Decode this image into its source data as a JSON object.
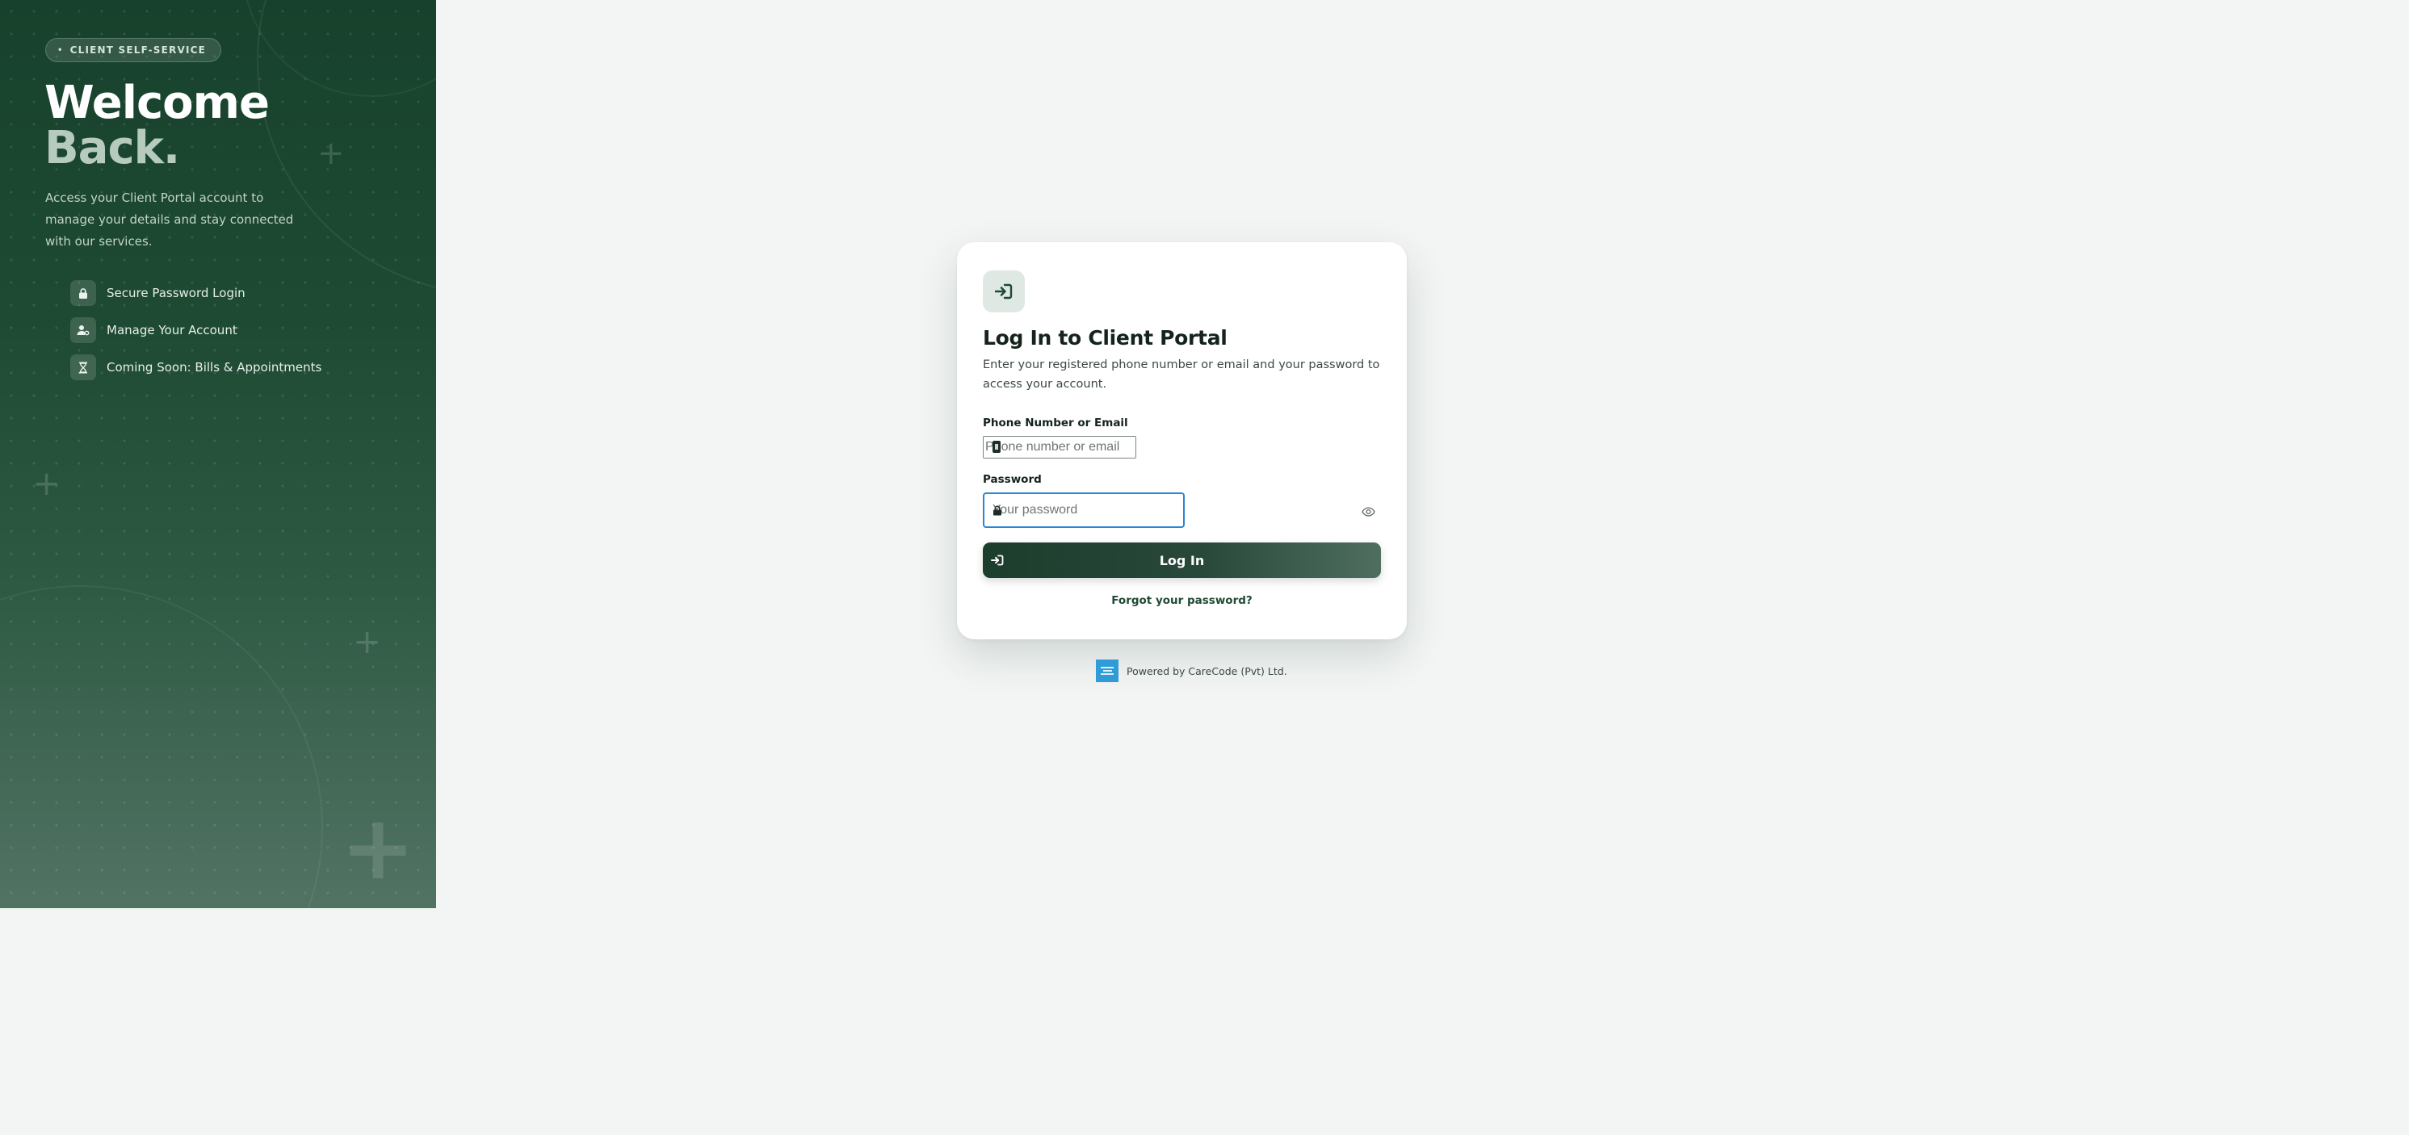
{
  "hero": {
    "badge_label": "CLIENT SELF-SERVICE",
    "title_line1": "Welcome",
    "title_line2": "Back.",
    "description": "Access your Client Portal account to manage your details and stay connected with our services.",
    "features": [
      {
        "icon": "lock-icon",
        "label": "Secure Password Login"
      },
      {
        "icon": "user-cog-icon",
        "label": "Manage Your Account"
      },
      {
        "icon": "hourglass-icon",
        "label": "Coming Soon: Bills & Appointments"
      }
    ]
  },
  "login_card": {
    "icon": "sign-in-icon",
    "title": "Log In to Client Portal",
    "subtitle": "Enter your registered phone number or email and your password to access your account.",
    "phone_label": "Phone Number or Email",
    "phone_placeholder": "Phone number or email",
    "phone_value": "",
    "password_label": "Password",
    "password_placeholder": "Your password",
    "password_value": "",
    "login_button_label": "Log In",
    "forgot_link_label": "Forgot your password?"
  },
  "footer": {
    "text": "Powered by CareCode (Pvt) Ltd."
  },
  "colors": {
    "brand_dark": "#1c3d2c",
    "brand_light": "#4f6e60",
    "focus_ring": "#2b86d6",
    "footer_logo": "#2f9cd8"
  }
}
